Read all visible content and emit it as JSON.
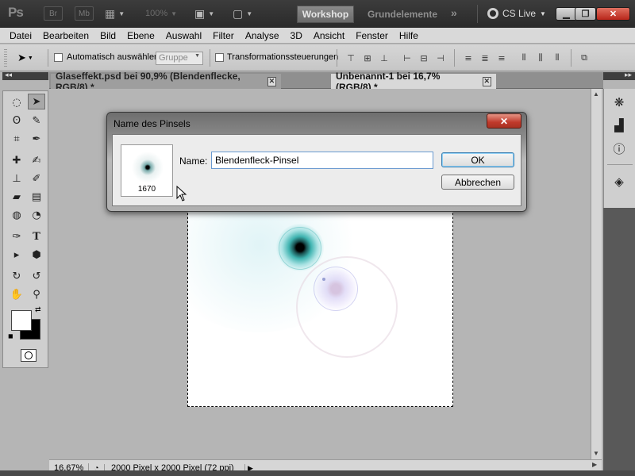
{
  "titlebar": {
    "logo": "Ps",
    "br_label": "Br",
    "mb_label": "Mb",
    "zoom": "100%",
    "workspace_active": "Workshop",
    "workspace_other": "Grundelemente",
    "more": "»",
    "cs_live": "CS Live"
  },
  "menu": [
    "Datei",
    "Bearbeiten",
    "Bild",
    "Ebene",
    "Auswahl",
    "Filter",
    "Analyse",
    "3D",
    "Ansicht",
    "Fenster",
    "Hilfe"
  ],
  "options": {
    "auto_select_label": "Automatisch auswählen:",
    "auto_select_value": "Gruppe",
    "transform_label": "Transformationssteuerungen"
  },
  "tabs": [
    {
      "label": "Glaseffekt.psd bei 90,9% (Blendenflecke, RGB/8) *"
    },
    {
      "label": "Unbenannt-1 bei 16,7% (RGB/8) *"
    }
  ],
  "status": {
    "zoom": "16,67%",
    "doc_info": "2000 Pixel x 2000 Pixel (72 ppi)"
  },
  "dialog": {
    "title": "Name des Pinsels",
    "brush_size": "1670",
    "name_label": "Name:",
    "name_value": "Blendenfleck-Pinsel",
    "ok_label": "OK",
    "cancel_label": "Abbrechen"
  }
}
